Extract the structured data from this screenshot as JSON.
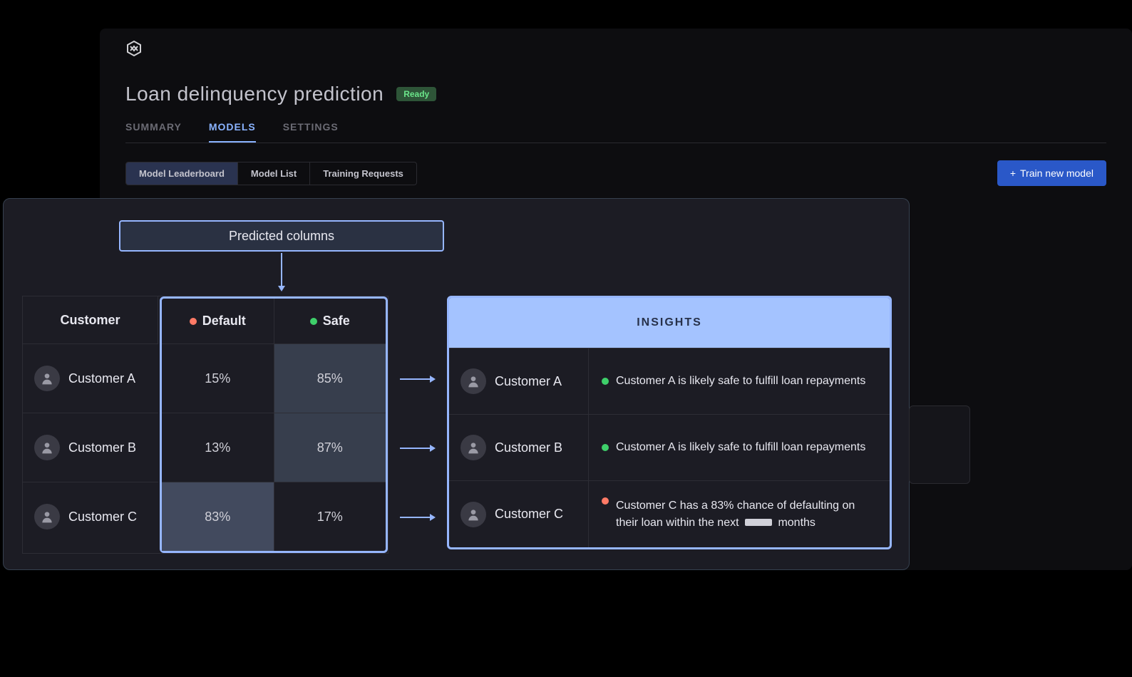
{
  "page": {
    "title": "Loan delinquency prediction",
    "status": "Ready"
  },
  "tabs": [
    {
      "label": "SUMMARY",
      "active": false
    },
    {
      "label": "MODELS",
      "active": true
    },
    {
      "label": "SETTINGS",
      "active": false
    }
  ],
  "subtabs": [
    {
      "label": "Model Leaderboard",
      "active": true
    },
    {
      "label": "Model List",
      "active": false
    },
    {
      "label": "Training Requests",
      "active": false
    }
  ],
  "actions": {
    "train_new_model": "Train new model"
  },
  "overlay": {
    "predicted_columns_label": "Predicted columns",
    "table": {
      "customer_header": "Customer",
      "columns": [
        {
          "label": "Default",
          "color": "red"
        },
        {
          "label": "Safe",
          "color": "green"
        }
      ],
      "rows": [
        {
          "name": "Customer A",
          "default": "15%",
          "safe": "85%"
        },
        {
          "name": "Customer B",
          "default": "13%",
          "safe": "87%"
        },
        {
          "name": "Customer C",
          "default": "83%",
          "safe": "17%"
        }
      ]
    },
    "insights": {
      "header": "INSIGHTS",
      "rows": [
        {
          "name": "Customer A",
          "color": "green",
          "text": "Customer A is likely safe to fulfill loan repayments"
        },
        {
          "name": "Customer B",
          "color": "green",
          "text": "Customer A is likely safe to fulfill loan repayments"
        },
        {
          "name": "Customer C",
          "color": "red",
          "text_pre": "Customer C has a 83% chance of defaulting on their loan within the next",
          "text_post": "months"
        }
      ]
    }
  }
}
